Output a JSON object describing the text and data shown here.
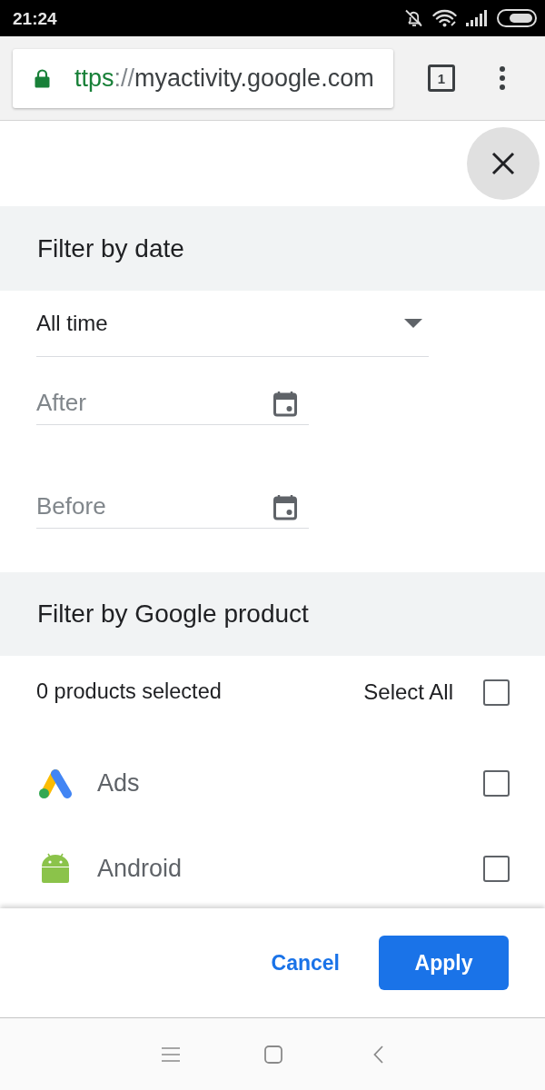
{
  "status_bar": {
    "time": "21:24"
  },
  "browser": {
    "url": {
      "scheme": "ttps",
      "separator": "://",
      "host": "myactivity.google.com"
    },
    "tab_count": "1"
  },
  "date_filter": {
    "title": "Filter by date",
    "range": {
      "value": "All time"
    },
    "fields": [
      {
        "placeholder": "After"
      },
      {
        "placeholder": "Before"
      }
    ]
  },
  "product_filter": {
    "title": "Filter by Google product",
    "summary": "0 products selected",
    "select_all": {
      "label": "Select All",
      "checked": false
    },
    "products": [
      {
        "name": "Ads",
        "checked": false
      },
      {
        "name": "Android",
        "checked": false
      }
    ]
  },
  "actions": {
    "cancel": "Cancel",
    "apply": "Apply"
  }
}
